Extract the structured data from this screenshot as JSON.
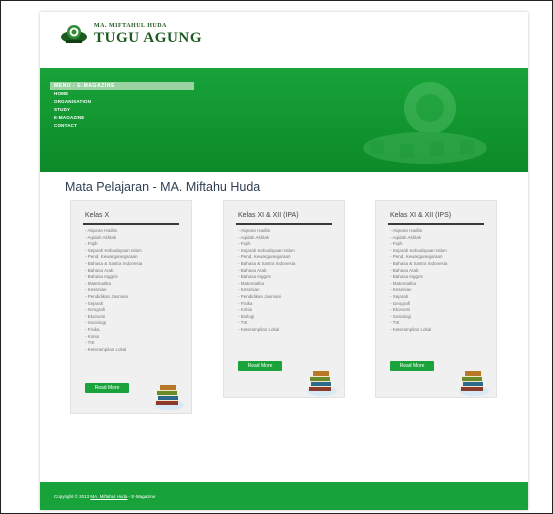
{
  "logo": {
    "line1": "MA. MIFTAHUL HUDA",
    "line2": "TUGU AGUNG"
  },
  "menu": {
    "heading": "MENU - E-MAGAZINE",
    "items": [
      {
        "label": "HOME"
      },
      {
        "label": "ORGANISATION"
      },
      {
        "label": "STUDY"
      },
      {
        "label": "E-MAGAZINE"
      },
      {
        "label": "CONTACT"
      }
    ]
  },
  "page_title": "Mata Pelajaran - MA. Miftahu Huda",
  "cards": [
    {
      "heading": "Kelas X",
      "subjects": [
        "Alquran Hadits",
        "Aqidah Akhlak",
        "Fiqih",
        "Sejarah Kebudayaan Islam",
        "Pend. Kewarganegaraan",
        "Bahasa & Sastra Indonesia",
        "Bahasa Arab",
        "Bahasa Inggris",
        "Matematika",
        "Kesenian",
        "Pendidikan Jasmani",
        "Sejarah",
        "Geografi",
        "Ekonomi",
        "Sosiologi",
        "Fisika",
        "Kimia",
        "TIK",
        "Keterampilan Lokal"
      ],
      "button": "Read More"
    },
    {
      "heading": "Kelas XI & XII (IPA)",
      "subjects": [
        "Alquran Hadits",
        "Aqidah Akhlak",
        "Fiqih",
        "Sejarah Kebudayaan Islam",
        "Pend. Kewarganegaraan",
        "Bahasa & Sastra Indonesia",
        "Bahasa Arab",
        "Bahasa Inggris",
        "Matematika",
        "Kesenian",
        "Pendidikan Jasmani",
        "Fisika",
        "Kimia",
        "Biologi",
        "TIK",
        "Keterampilan Lokal"
      ],
      "button": "Read More"
    },
    {
      "heading": "Kelas XI & XII (IPS)",
      "subjects": [
        "Alquran Hadits",
        "Aqidah Akhlak",
        "Fiqih",
        "Sejarah Kebudayaan Islam",
        "Pend. Kewarganegaraan",
        "Bahasa & Sastra Indonesia",
        "Bahasa Arab",
        "Bahasa Inggris",
        "Matematika",
        "Kesenian",
        "Sejarah",
        "Geografi",
        "Ekonomi",
        "Sosiologi",
        "TIK",
        "Keterampilan Lokal"
      ],
      "button": "Read More"
    }
  ],
  "footer": {
    "copyright": "Copyright © 2013",
    "link": "MA. Miftahul Huda",
    "suffix": "- E-Magazine"
  },
  "colors": {
    "brand_green": "#17a33a",
    "logo_text": "#1c5a1f"
  },
  "icons": {
    "logo": "school-emblem-icon",
    "watermark": "school-emblem-watermark",
    "books": "books-stack-icon"
  }
}
